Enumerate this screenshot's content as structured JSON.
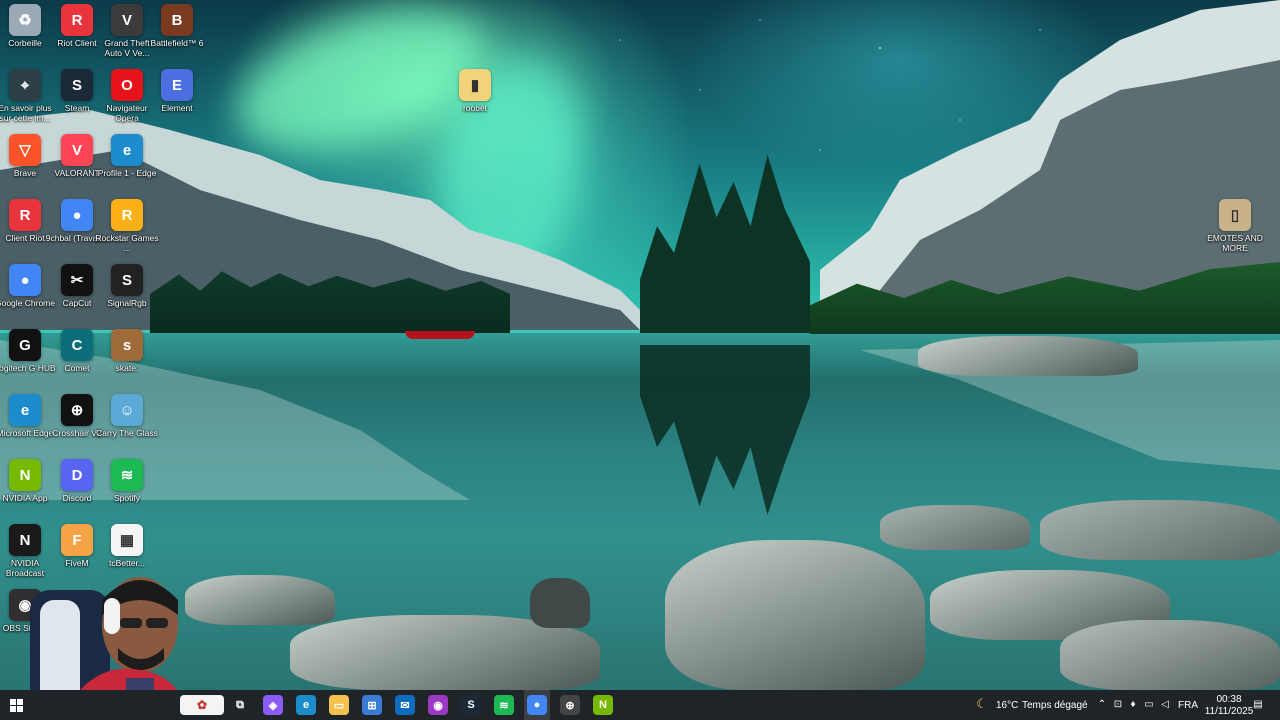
{
  "desktop": {
    "icons": [
      {
        "label": "Corbeille",
        "icon": "recycle-bin-icon",
        "color": "#9aa9b5",
        "glyph": "♻"
      },
      {
        "label": "Riot Client",
        "icon": "riot-client-icon",
        "color": "#e8343d",
        "glyph": "R"
      },
      {
        "label": "Grand Theft Auto V Ve...",
        "icon": "gta-v-icon",
        "color": "#3b3b3b",
        "glyph": "V"
      },
      {
        "label": "Battlefield™ 6",
        "icon": "battlefield-icon",
        "color": "#7a3a1f",
        "glyph": "B"
      },
      {
        "label": "En savoir plus sur cette im...",
        "icon": "learn-more-icon",
        "color": "#2c3e46",
        "glyph": "⌖"
      },
      {
        "label": "Steam",
        "icon": "steam-icon",
        "color": "#1b2838",
        "glyph": "S"
      },
      {
        "label": "Navigateur Opera",
        "icon": "opera-icon",
        "color": "#e7131a",
        "glyph": "O"
      },
      {
        "label": "Element",
        "icon": "element-icon",
        "color": "#4b6fe0",
        "glyph": "E"
      },
      {
        "label": "Brave",
        "icon": "brave-icon",
        "color": "#fb542b",
        "glyph": "▽"
      },
      {
        "label": "VALORANT",
        "icon": "valorant-icon",
        "color": "#fd4556",
        "glyph": "V"
      },
      {
        "label": "Profile 1 - Edge",
        "icon": "edge-profile-icon",
        "color": "#1c8ccd",
        "glyph": "e"
      },
      {
        "label": "Client Riot",
        "icon": "riot-client-icon",
        "color": "#e8343d",
        "glyph": "R"
      },
      {
        "label": "9chbal (Travail...",
        "icon": "chrome-icon",
        "color": "#4285f4",
        "glyph": "●"
      },
      {
        "label": "Rockstar Games ...",
        "icon": "rockstar-icon",
        "color": "#fcaf17",
        "glyph": "R"
      },
      {
        "label": "Google Chrome",
        "icon": "chrome-icon",
        "color": "#4285f4",
        "glyph": "●"
      },
      {
        "label": "CapCut",
        "icon": "capcut-icon",
        "color": "#111111",
        "glyph": "✂"
      },
      {
        "label": "SignalRgb",
        "icon": "signalrgb-icon",
        "color": "#222222",
        "glyph": "S"
      },
      {
        "label": "Logitech G HUB",
        "icon": "logitech-icon",
        "color": "#111111",
        "glyph": "G"
      },
      {
        "label": "Comet",
        "icon": "comet-icon",
        "color": "#0c6e7a",
        "glyph": "C"
      },
      {
        "label": "skate.",
        "icon": "skate-icon",
        "color": "#a06b3a",
        "glyph": "s"
      },
      {
        "label": "Microsoft Edge",
        "icon": "edge-icon",
        "color": "#1c8ccd",
        "glyph": "e"
      },
      {
        "label": "Crosshair V2",
        "icon": "crosshair-icon",
        "color": "#111111",
        "glyph": "⊕"
      },
      {
        "label": "Carry The Glass",
        "icon": "carry-glass-icon",
        "color": "#5aa9d6",
        "glyph": "☺"
      },
      {
        "label": "NVIDIA App",
        "icon": "nvidia-icon",
        "color": "#76b900",
        "glyph": "N"
      },
      {
        "label": "Discord",
        "icon": "discord-icon",
        "color": "#5865f2",
        "glyph": "D"
      },
      {
        "label": "Spotify",
        "icon": "spotify-icon",
        "color": "#1db954",
        "glyph": "≋"
      },
      {
        "label": "NVIDIA Broadcast",
        "icon": "nvidia-broadcast-icon",
        "color": "#1a1a1a",
        "glyph": "N"
      },
      {
        "label": "FiveM",
        "icon": "fivem-icon",
        "color": "#f6a345",
        "glyph": "F"
      },
      {
        "label": "tcBetter...",
        "icon": "qr-code-icon",
        "color": "#f5f5f5",
        "glyph": "▦"
      },
      {
        "label": "OBS Studio",
        "icon": "obs-icon",
        "color": "#302e31",
        "glyph": "◉"
      },
      {
        "label": "roobet",
        "icon": "folder-icon",
        "color": "#f2d27a",
        "glyph": "▮"
      },
      {
        "label": "EMOTES AND MORE",
        "icon": "emotes-icon",
        "color": "#c9b28a",
        "glyph": "▯"
      }
    ]
  },
  "taskbar": {
    "start_icon": "windows-start-icon",
    "search_placeholder": "",
    "apps": [
      {
        "name": "task-view",
        "glyph": "⧉",
        "color": "#1f2429"
      },
      {
        "name": "copilot",
        "glyph": "◈",
        "color": "#8a5cf6"
      },
      {
        "name": "edge",
        "glyph": "e",
        "color": "#1c8ccd"
      },
      {
        "name": "file-explorer",
        "glyph": "▭",
        "color": "#f2c14e"
      },
      {
        "name": "store",
        "glyph": "⊞",
        "color": "#3a7bd5"
      },
      {
        "name": "outlook",
        "glyph": "✉",
        "color": "#0f6cbd"
      },
      {
        "name": "obs",
        "glyph": "◉",
        "color": "#9a3ac4"
      },
      {
        "name": "steam",
        "glyph": "S",
        "color": "#1b2838"
      },
      {
        "name": "spotify",
        "glyph": "≋",
        "color": "#1db954"
      },
      {
        "name": "chrome",
        "glyph": "●",
        "color": "#4285f4"
      },
      {
        "name": "crosshair",
        "glyph": "⊕",
        "color": "#444444"
      },
      {
        "name": "nvidia-broadcast",
        "glyph": "N",
        "color": "#76b900"
      }
    ],
    "weather": {
      "temp": "16°C",
      "desc": "Temps dégagé"
    },
    "language": "FRA",
    "time": "00:38",
    "date": "11/11/2025"
  }
}
